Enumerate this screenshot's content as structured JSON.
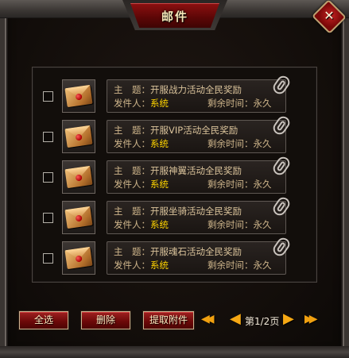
{
  "window": {
    "title": "邮件",
    "close_label": "✕"
  },
  "labels": {
    "subject": "主　题：",
    "sender": "发件人：",
    "remaining": "剩余时间："
  },
  "mails": [
    {
      "subject": "开服战力活动全民奖励",
      "sender": "系统",
      "remaining": "永久"
    },
    {
      "subject": "开服VIP活动全民奖励",
      "sender": "系统",
      "remaining": "永久"
    },
    {
      "subject": "开服神翼活动全民奖励",
      "sender": "系统",
      "remaining": "永久"
    },
    {
      "subject": "开服坐骑活动全民奖励",
      "sender": "系统",
      "remaining": "永久"
    },
    {
      "subject": "开服魂石活动全民奖励",
      "sender": "系统",
      "remaining": "永久"
    }
  ],
  "buttons": {
    "select_all": "全选",
    "delete": "删除",
    "extract": "提取附件"
  },
  "pager": {
    "page_label": "第1/2页",
    "current": 1,
    "total": 2
  },
  "colors": {
    "sender_name": "#ffd400",
    "button_red": "#8a1010",
    "pager_arrow": "#f6a814"
  }
}
